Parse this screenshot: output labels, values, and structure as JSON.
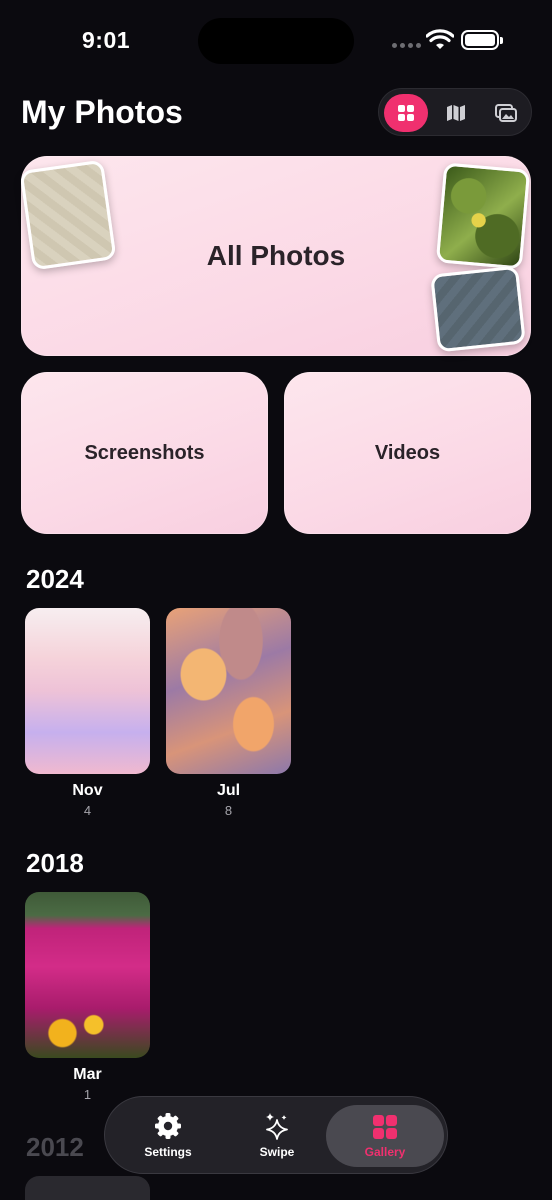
{
  "status_bar": {
    "time": "9:01"
  },
  "header": {
    "title": "My Photos",
    "view_modes": [
      {
        "icon": "grid-icon",
        "active": true
      },
      {
        "icon": "map-icon",
        "active": false
      },
      {
        "icon": "photo-stack-icon",
        "active": false
      }
    ]
  },
  "albums": {
    "all_photos": "All Photos",
    "screenshots": "Screenshots",
    "videos": "Videos"
  },
  "years": [
    {
      "year": "2024",
      "months": [
        {
          "month": "Nov",
          "count": "4"
        },
        {
          "month": "Jul",
          "count": "8"
        }
      ]
    },
    {
      "year": "2018",
      "months": [
        {
          "month": "Mar",
          "count": "1"
        }
      ]
    },
    {
      "year": "2012",
      "months": []
    }
  ],
  "tab_bar": {
    "tabs": [
      {
        "label": "Settings",
        "icon": "gear-icon",
        "active": false
      },
      {
        "label": "Swipe",
        "icon": "sparkles-icon",
        "active": false
      },
      {
        "label": "Gallery",
        "icon": "grid-icon",
        "active": true
      }
    ]
  },
  "colors": {
    "accent": "#f0306f",
    "background": "#0b0a0f",
    "card": "#fbdbe6"
  }
}
